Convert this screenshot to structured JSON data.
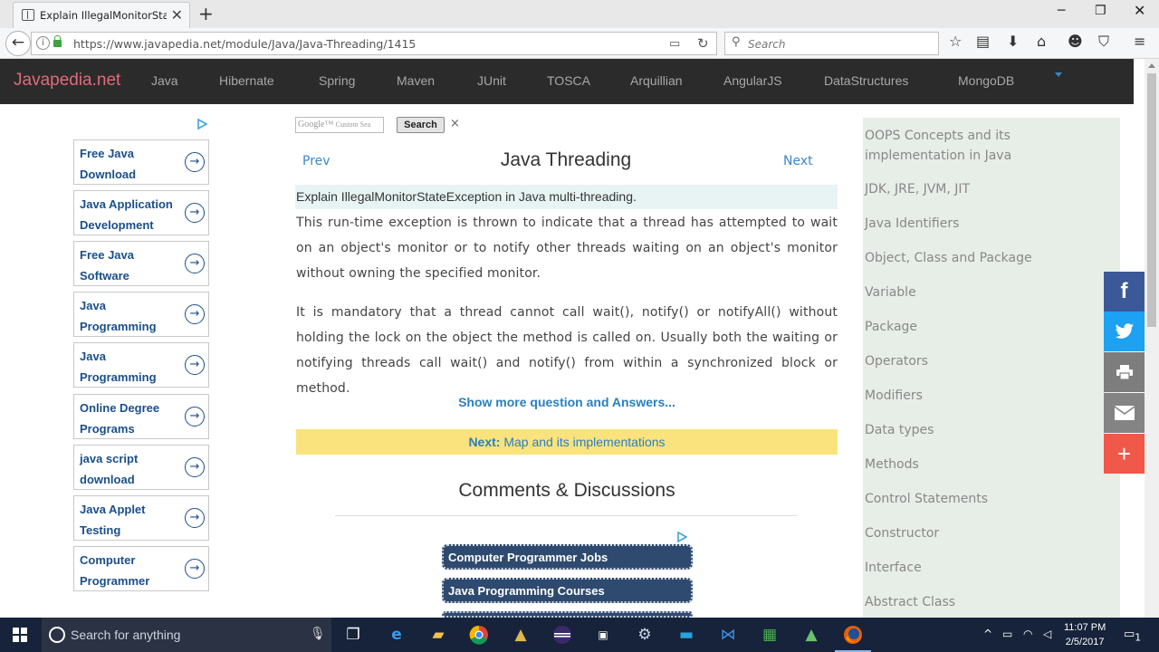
{
  "browser": {
    "tab_title": "Explain IllegalMonitorStat...",
    "url": "https://www.javapedia.net/module/Java/Java-Threading/1415",
    "search_placeholder": "Search"
  },
  "site": {
    "brand": "Javapedia.net",
    "nav": [
      "Java",
      "Hibernate",
      "Spring",
      "Maven",
      "JUnit",
      "TOSCA",
      "Arquillian",
      "AngularJS",
      "DataStructures",
      "MongoDB"
    ]
  },
  "left_ads": [
    "Free Java Download",
    "Java Application Development",
    "Free Java Software",
    "Java Programming",
    "Java Programming",
    "Online Degree Programs",
    "java script download",
    "Java Applet Testing",
    "Computer Programmer"
  ],
  "google_search": {
    "placeholder": "Custom Sea",
    "brand": "Google™",
    "button": "Search",
    "close": "×"
  },
  "article": {
    "prev": "Prev",
    "title": "Java Threading",
    "next": "Next",
    "question": "Explain IllegalMonitorStateException in Java multi-threading.",
    "para1": "This run-time exception is thrown to indicate that a thread has attempted to wait on an object's monitor or to notify other threads waiting on an object's monitor without owning the specified monitor.",
    "para2": "It is mandatory that a thread cannot call wait(), notify() or notifyAll() without holding the lock on the object the method is called on. Usually both the waiting or notifying threads call wait() and notify() from within a synchronized block or method.",
    "more_link": "Show more question and Answers...",
    "next_label": "Next:",
    "next_topic": "Map and its implementations",
    "comments_title": "Comments & Discussions"
  },
  "bottom_ads": [
    "Computer Programmer Jobs",
    "Java Programming Courses"
  ],
  "sidebar": [
    "OOPS Concepts and its implementation in Java",
    "JDK, JRE, JVM, JIT",
    "Java Identifiers",
    "Object, Class and Package",
    "Variable",
    "Package",
    "Operators",
    "Modifiers",
    "Data types",
    "Methods",
    "Control Statements",
    "Constructor",
    "Interface",
    "Abstract Class"
  ],
  "share": {
    "facebook": "f",
    "twitter": "t",
    "print": "print",
    "email": "email",
    "more": "+"
  },
  "taskbar": {
    "search_text": "Search for anything",
    "time": "11:07 PM",
    "date": "2/5/2017",
    "notifications": "1"
  },
  "colors": {
    "brand": "#e06a7b",
    "link": "#3b86c8",
    "next_bar": "#fae37c",
    "sidebar_bg": "#e7eee7",
    "nav_bg": "#2b2b2b"
  }
}
